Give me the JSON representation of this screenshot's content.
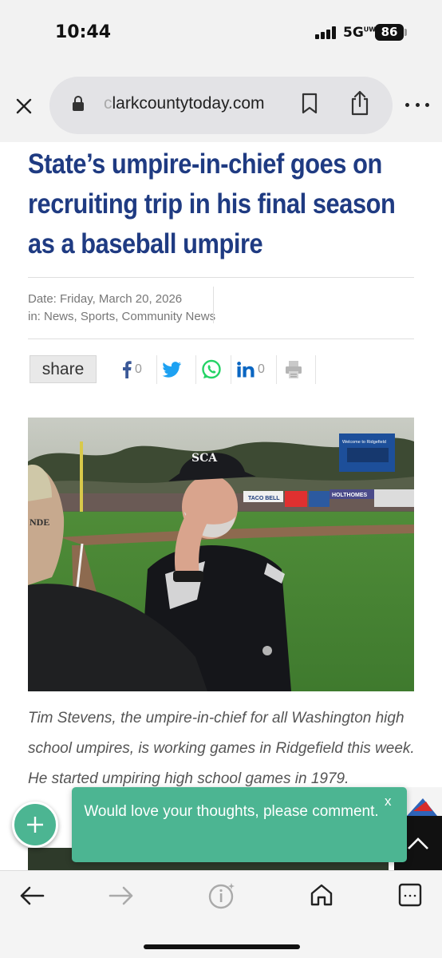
{
  "status": {
    "time": "10:44",
    "network": "5G",
    "network_sup": "UW",
    "battery": "86"
  },
  "browser": {
    "url_faded": "c",
    "url": "larkcountytoday.com",
    "icons": [
      "close-icon",
      "lock-icon",
      "bookmark-icon",
      "share-icon",
      "more-icon"
    ]
  },
  "article": {
    "headline": "State’s umpire-in-chief goes on recruiting trip in his final season as a baseball umpire",
    "date": "Date: Friday, March 20, 2026",
    "categories": "in: News, Sports, Community News",
    "share_label": "share",
    "facebook_count": "0",
    "linkedin_count": "0",
    "caption": "Tim Stevens, the umpire-in-chief for all Washington high school umpires, is working games in Ridgefield this week. He started umpiring high school games in 1979."
  },
  "photo": {
    "cap_logo": "SCA",
    "hat_text": "NDE",
    "banner_1": "TACO BELL",
    "banner_2": "HOLTHOMES",
    "scoreboard_top": "Welcome to Ridgefield"
  },
  "comment_toast": {
    "message": "Would love your thoughts, please comment.",
    "close": "x"
  },
  "colors": {
    "headline": "#1f3b82",
    "accent": "#4cb592",
    "link_blue": "#1da1f2",
    "whatsapp": "#25d366",
    "linkedin": "#0a66c2",
    "facebook": "#3b5998"
  }
}
